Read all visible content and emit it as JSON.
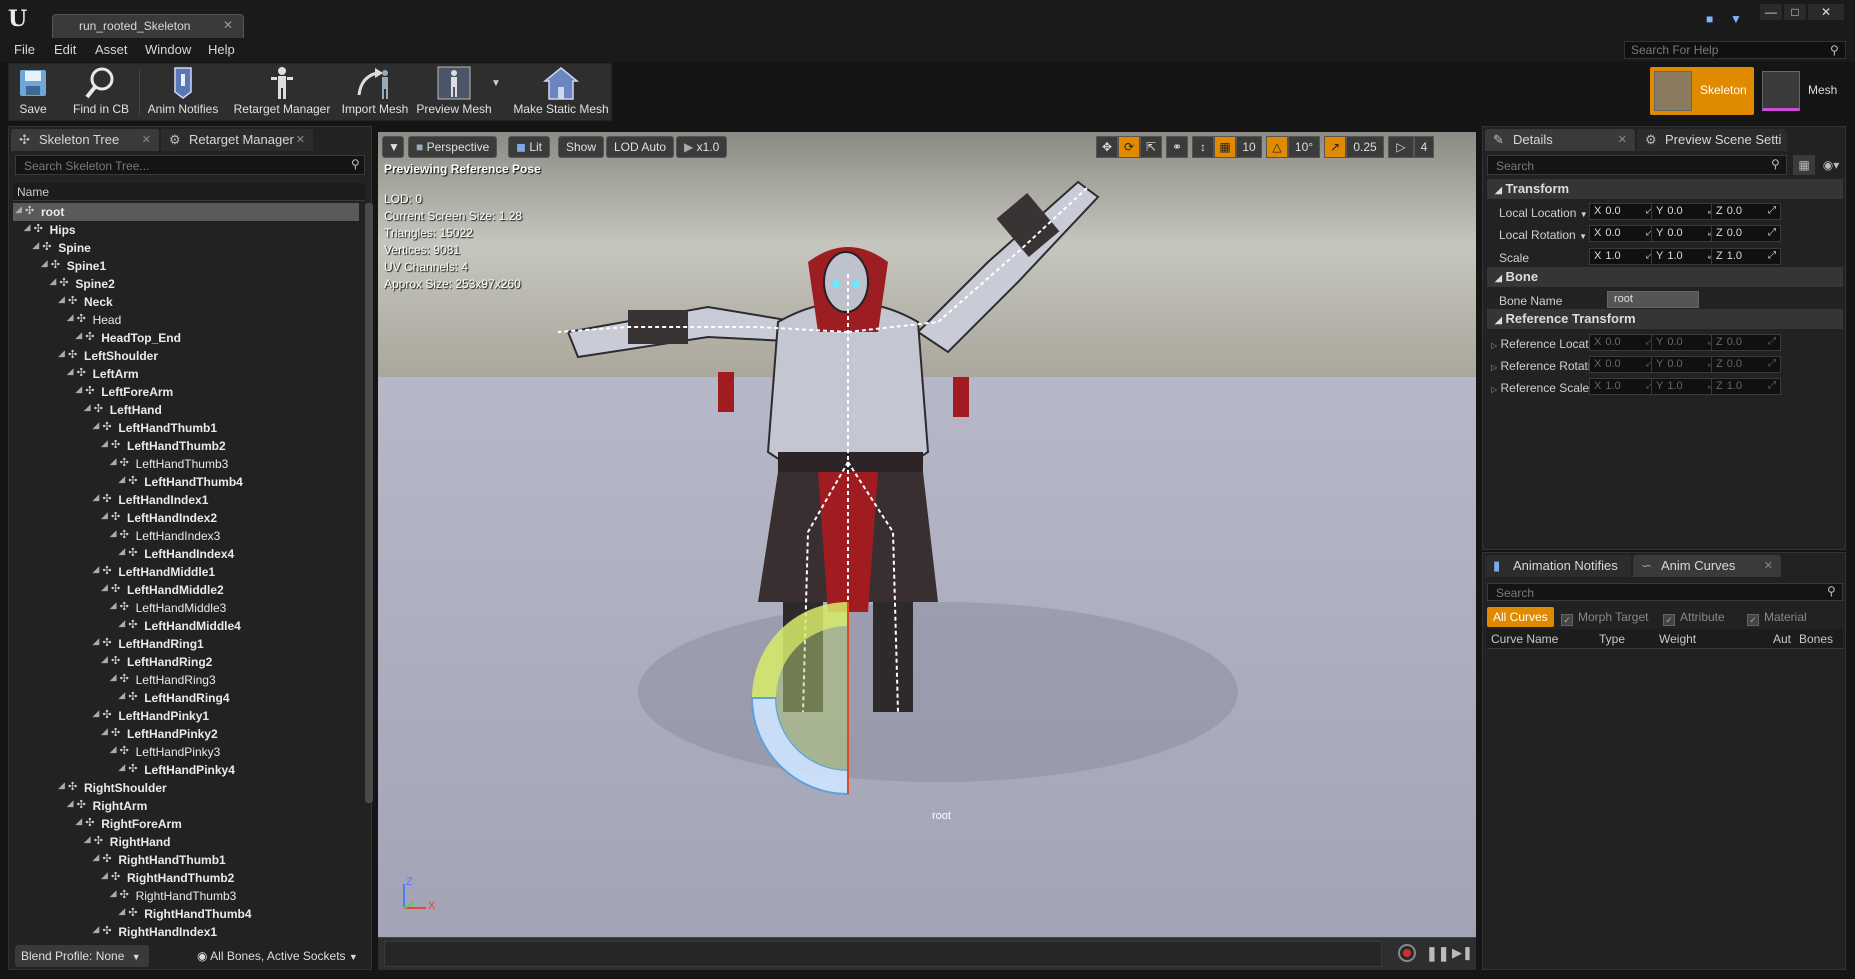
{
  "window": {
    "tab_title": "run_rooted_Skeleton",
    "tab_close": "✕",
    "minimize": "—",
    "maximize": "□",
    "close": "✕"
  },
  "menu": [
    "File",
    "Edit",
    "Asset",
    "Window",
    "Help"
  ],
  "help_search": {
    "placeholder": "Search For Help"
  },
  "toolbar": [
    {
      "label": "Save",
      "icon": "save-icon"
    },
    {
      "label": "Find in CB",
      "icon": "magnifier-icon"
    },
    {
      "label": "Anim Notifies",
      "icon": "notify-icon"
    },
    {
      "label": "Retarget Manager",
      "icon": "retarget-icon"
    },
    {
      "label": "Import Mesh",
      "icon": "import-mesh-icon"
    },
    {
      "label": "Preview Mesh",
      "icon": "preview-mesh-icon"
    },
    {
      "label": "Make Static Mesh",
      "icon": "static-mesh-icon"
    }
  ],
  "modes": [
    {
      "label": "Skeleton",
      "active": true
    },
    {
      "label": "Mesh",
      "active": false
    }
  ],
  "left_tabs": [
    {
      "label": "Skeleton Tree"
    },
    {
      "label": "Retarget Manager"
    }
  ],
  "skeleton_search": {
    "placeholder": "Search Skeleton Tree..."
  },
  "tree_header": "Name",
  "bones": [
    {
      "name": "root",
      "depth": 0,
      "bold": true,
      "selected": true
    },
    {
      "name": "Hips",
      "depth": 1,
      "bold": true
    },
    {
      "name": "Spine",
      "depth": 2,
      "bold": true
    },
    {
      "name": "Spine1",
      "depth": 3,
      "bold": true
    },
    {
      "name": "Spine2",
      "depth": 4,
      "bold": true
    },
    {
      "name": "Neck",
      "depth": 5,
      "bold": true
    },
    {
      "name": "Head",
      "depth": 6,
      "bold": false
    },
    {
      "name": "HeadTop_End",
      "depth": 7,
      "bold": true
    },
    {
      "name": "LeftShoulder",
      "depth": 5,
      "bold": true
    },
    {
      "name": "LeftArm",
      "depth": 6,
      "bold": true
    },
    {
      "name": "LeftForeArm",
      "depth": 7,
      "bold": true
    },
    {
      "name": "LeftHand",
      "depth": 8,
      "bold": true
    },
    {
      "name": "LeftHandThumb1",
      "depth": 9,
      "bold": true
    },
    {
      "name": "LeftHandThumb2",
      "depth": 10,
      "bold": true
    },
    {
      "name": "LeftHandThumb3",
      "depth": 11,
      "bold": false
    },
    {
      "name": "LeftHandThumb4",
      "depth": 12,
      "bold": true
    },
    {
      "name": "LeftHandIndex1",
      "depth": 9,
      "bold": true
    },
    {
      "name": "LeftHandIndex2",
      "depth": 10,
      "bold": true
    },
    {
      "name": "LeftHandIndex3",
      "depth": 11,
      "bold": false
    },
    {
      "name": "LeftHandIndex4",
      "depth": 12,
      "bold": true
    },
    {
      "name": "LeftHandMiddle1",
      "depth": 9,
      "bold": true
    },
    {
      "name": "LeftHandMiddle2",
      "depth": 10,
      "bold": true
    },
    {
      "name": "LeftHandMiddle3",
      "depth": 11,
      "bold": false
    },
    {
      "name": "LeftHandMiddle4",
      "depth": 12,
      "bold": true
    },
    {
      "name": "LeftHandRing1",
      "depth": 9,
      "bold": true
    },
    {
      "name": "LeftHandRing2",
      "depth": 10,
      "bold": true
    },
    {
      "name": "LeftHandRing3",
      "depth": 11,
      "bold": false
    },
    {
      "name": "LeftHandRing4",
      "depth": 12,
      "bold": true
    },
    {
      "name": "LeftHandPinky1",
      "depth": 9,
      "bold": true
    },
    {
      "name": "LeftHandPinky2",
      "depth": 10,
      "bold": true
    },
    {
      "name": "LeftHandPinky3",
      "depth": 11,
      "bold": false
    },
    {
      "name": "LeftHandPinky4",
      "depth": 12,
      "bold": true
    },
    {
      "name": "RightShoulder",
      "depth": 5,
      "bold": true
    },
    {
      "name": "RightArm",
      "depth": 6,
      "bold": true
    },
    {
      "name": "RightForeArm",
      "depth": 7,
      "bold": true
    },
    {
      "name": "RightHand",
      "depth": 8,
      "bold": true
    },
    {
      "name": "RightHandThumb1",
      "depth": 9,
      "bold": true
    },
    {
      "name": "RightHandThumb2",
      "depth": 10,
      "bold": true
    },
    {
      "name": "RightHandThumb3",
      "depth": 11,
      "bold": false
    },
    {
      "name": "RightHandThumb4",
      "depth": 12,
      "bold": true
    },
    {
      "name": "RightHandIndex1",
      "depth": 9,
      "bold": true
    }
  ],
  "blend_profile": "Blend Profile: None",
  "bones_filter": "All Bones, Active Sockets",
  "viewport": {
    "perspective": "Perspective",
    "lit": "Lit",
    "show": "Show",
    "lod": "LOD Auto",
    "speed": "x1.0",
    "previewing": "Previewing Reference Pose",
    "stats": [
      "LOD: 0",
      "Current Screen Size: 1.28",
      "Triangles: 15022",
      "Vertices: 9081",
      "UV Channels: 4",
      "Approx Size: 253x97x260"
    ],
    "grid_snap": "10",
    "rot_snap": "10°",
    "scale_snap": "0.25",
    "cam_speed": "4",
    "root_label": "root",
    "axis_z": "Z",
    "axis_x": "X"
  },
  "details_tabs": [
    {
      "label": "Details"
    },
    {
      "label": "Preview Scene Setti"
    }
  ],
  "details_search": {
    "placeholder": "Search"
  },
  "transform": {
    "title": "Transform",
    "location_label": "Local Location",
    "rotation_label": "Local Rotation",
    "scale_label": "Scale",
    "location": [
      "0.0",
      "0.0",
      "0.0"
    ],
    "rotation": [
      "0.0",
      "0.0",
      "0.0"
    ],
    "scale": [
      "1.0",
      "1.0",
      "1.0"
    ]
  },
  "bone": {
    "title": "Bone",
    "name_label": "Bone Name",
    "name_value": "root"
  },
  "reference": {
    "title": "Reference Transform",
    "location_label": "Reference Location",
    "rotation_label": "Reference Rotation",
    "scale_label": "Reference Scale",
    "location": [
      "0.0",
      "0.0",
      "0.0"
    ],
    "rotation": [
      "0.0",
      "0.0",
      "0.0"
    ],
    "scale": [
      "1.0",
      "1.0",
      "1.0"
    ]
  },
  "axes": [
    "X",
    "Y",
    "Z"
  ],
  "anim_tabs": [
    {
      "label": "Animation Notifies"
    },
    {
      "label": "Anim Curves"
    }
  ],
  "curves_search": {
    "placeholder": "Search"
  },
  "curve_filters": {
    "all": "All Curves",
    "morph": "Morph Target",
    "attribute": "Attribute",
    "material": "Material"
  },
  "curve_columns": [
    "Curve Name",
    "Type",
    "Weight",
    "Aut",
    "Bones"
  ],
  "colors": {
    "accent": "#e08a00",
    "panel": "#222222",
    "selected": "#5a5a5a"
  }
}
